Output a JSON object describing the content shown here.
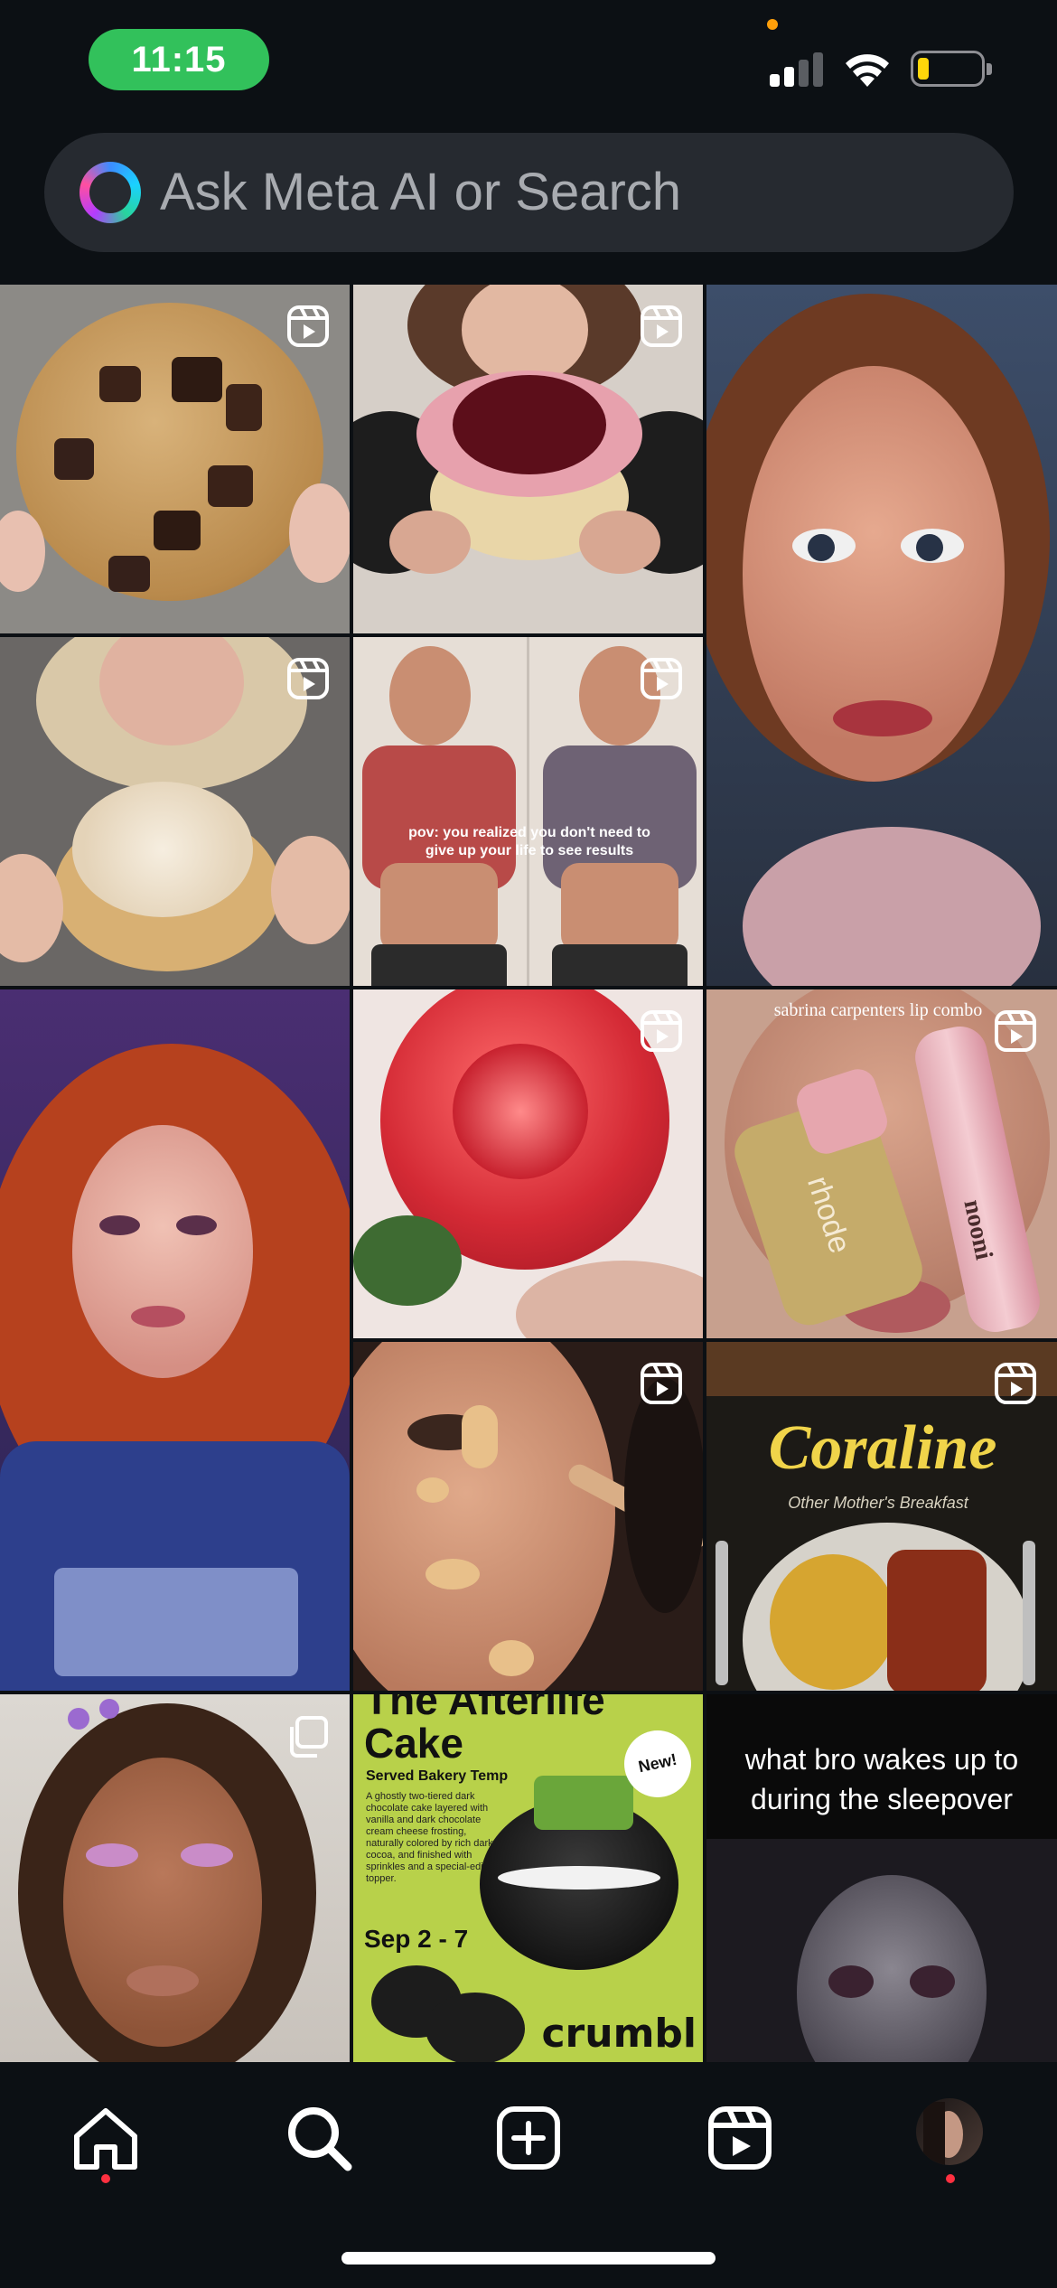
{
  "status_bar": {
    "time": "11:15",
    "battery_color": "#ffd60a",
    "time_pill_color": "#32c15b"
  },
  "search": {
    "placeholder": "Ask Meta AI or Search",
    "icon": "meta-ai-ring-icon"
  },
  "grid": {
    "tiles": [
      {
        "name": "tile-cookie",
        "badge": "reel-icon"
      },
      {
        "name": "tile-jam-cookie",
        "badge": "reel-icon"
      },
      {
        "name": "tile-portrait-woman",
        "badge": "none"
      },
      {
        "name": "tile-frosted-cookie",
        "badge": "reel-icon"
      },
      {
        "name": "tile-fitness",
        "badge": "reel-icon",
        "caption": "pov: you realized you don't need to give up your life to see results"
      },
      {
        "name": "tile-red-hair",
        "badge": "none"
      },
      {
        "name": "tile-rose-jelly",
        "badge": "reel-icon"
      },
      {
        "name": "tile-lip-combo",
        "badge": "reel-icon",
        "caption": "sabrina carpenters lip combo",
        "brand_left": "rhode",
        "brand_right": "nooni"
      },
      {
        "name": "tile-makeup-face",
        "badge": "reel-icon"
      },
      {
        "name": "tile-coraline",
        "badge": "reel-icon",
        "title": "Coraline",
        "subtitle": "Other Mother's Breakfast"
      },
      {
        "name": "tile-braids-portrait",
        "badge": "multi-icon"
      },
      {
        "name": "tile-crumbl",
        "badge": "none",
        "title": "The Afterlife Cake",
        "subtitle": "Served Bakery Temp",
        "description": "A ghostly two-tiered dark chocolate cake layered with vanilla and dark chocolate cream cheese frosting, naturally colored by rich dark cocoa, and finished with sprinkles and a special-edition topper.",
        "dates": "Sep 2 - 7",
        "brand": "crumbl",
        "new_badge": "New!"
      },
      {
        "name": "tile-sleepover-meme",
        "badge": "none",
        "caption": "what bro wakes up to during the sleepover"
      }
    ]
  },
  "bottom_nav": {
    "items": [
      "home-icon",
      "search-icon",
      "create-icon",
      "reels-icon",
      "profile-avatar"
    ],
    "notification_dot_color": "#ff3040"
  }
}
